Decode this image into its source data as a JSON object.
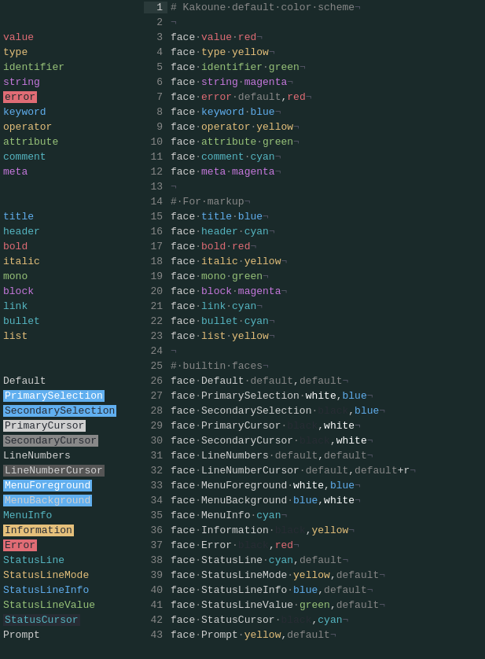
{
  "editor": {
    "title": "Kakoune default color scheme",
    "lines": [
      {
        "num": 1,
        "current": true,
        "left": "",
        "left_class": "",
        "code": "# Kakoune·default·color·scheme¬",
        "hash": true
      },
      {
        "num": 2,
        "left": "",
        "left_class": "",
        "code": "¬",
        "hash": false
      },
      {
        "num": 3,
        "left": "value",
        "left_class": "lbl-value",
        "code": "face·value·red¬",
        "hash": false
      },
      {
        "num": 4,
        "left": "type",
        "left_class": "lbl-type",
        "code": "face·type·yellow¬",
        "hash": false
      },
      {
        "num": 5,
        "left": "identifier",
        "left_class": "lbl-identifier",
        "code": "face·identifier·green¬",
        "hash": false
      },
      {
        "num": 6,
        "left": "string",
        "left_class": "lbl-string",
        "code": "face·string·magenta¬",
        "hash": false
      },
      {
        "num": 7,
        "left": "error",
        "left_class": "lbl-error",
        "code": "face·error·default,red¬",
        "hash": false
      },
      {
        "num": 8,
        "left": "keyword",
        "left_class": "lbl-keyword",
        "code": "face·keyword·blue¬",
        "hash": false
      },
      {
        "num": 9,
        "left": "operator",
        "left_class": "lbl-operator",
        "code": "face·operator·yellow¬",
        "hash": false
      },
      {
        "num": 10,
        "left": "attribute",
        "left_class": "lbl-attribute",
        "code": "face·attribute·green¬",
        "hash": false
      },
      {
        "num": 11,
        "left": "comment",
        "left_class": "lbl-comment",
        "code": "face·comment·cyan¬",
        "hash": false
      },
      {
        "num": 12,
        "left": "meta",
        "left_class": "lbl-meta",
        "code": "face·meta·magenta¬",
        "hash": false
      },
      {
        "num": 13,
        "left": "",
        "left_class": "",
        "code": "¬",
        "hash": false
      },
      {
        "num": 14,
        "left": "",
        "left_class": "",
        "code": "#·For·markup¬",
        "hash": true
      },
      {
        "num": 15,
        "left": "title",
        "left_class": "lbl-title",
        "code": "face·title·blue¬",
        "hash": false
      },
      {
        "num": 16,
        "left": "header",
        "left_class": "lbl-header",
        "code": "face·header·cyan¬",
        "hash": false
      },
      {
        "num": 17,
        "left": "bold",
        "left_class": "lbl-bold",
        "code": "face·bold·red¬",
        "hash": false
      },
      {
        "num": 18,
        "left": "italic",
        "left_class": "lbl-italic",
        "code": "face·italic·yellow¬",
        "hash": false
      },
      {
        "num": 19,
        "left": "mono",
        "left_class": "lbl-mono",
        "code": "face·mono·green¬",
        "hash": false
      },
      {
        "num": 20,
        "left": "block",
        "left_class": "lbl-block",
        "code": "face·block·magenta¬",
        "hash": false
      },
      {
        "num": 21,
        "left": "link",
        "left_class": "lbl-link",
        "code": "face·link·cyan¬",
        "hash": false
      },
      {
        "num": 22,
        "left": "bullet",
        "left_class": "lbl-bullet",
        "code": "face·bullet·cyan¬",
        "hash": false
      },
      {
        "num": 23,
        "left": "list",
        "left_class": "lbl-list",
        "code": "face·list·yellow¬",
        "hash": false
      },
      {
        "num": 24,
        "left": "",
        "left_class": "",
        "code": "¬",
        "hash": false
      },
      {
        "num": 25,
        "left": "",
        "left_class": "",
        "code": "#·builtin·faces¬",
        "hash": true
      },
      {
        "num": 26,
        "left": "Default",
        "left_class": "lbl-default",
        "code": "face·Default·default,default¬",
        "hash": false
      },
      {
        "num": 27,
        "left": "PrimarySelection",
        "left_class": "lbl-primaryselection",
        "code": "face·PrimarySelection·white,blue¬",
        "hash": false
      },
      {
        "num": 28,
        "left": "SecondarySelection",
        "left_class": "lbl-secondaryselection",
        "code": "face·SecondarySelection·black,blue¬",
        "hash": false
      },
      {
        "num": 29,
        "left": "PrimaryCursor",
        "left_class": "lbl-primarycursor",
        "code": "face·PrimaryCursor·black,white¬",
        "hash": false
      },
      {
        "num": 30,
        "left": "SecondaryCursor",
        "left_class": "lbl-secondarycursor",
        "code": "face·SecondaryCursor·black,white¬",
        "hash": false
      },
      {
        "num": 31,
        "left": "LineNumbers",
        "left_class": "lbl-linenumbers",
        "code": "face·LineNumbers·default,default¬",
        "hash": false
      },
      {
        "num": 32,
        "left": "LineNumberCursor",
        "left_class": "lbl-linenumbercursor",
        "code": "face·LineNumberCursor·default,default+r¬",
        "hash": false
      },
      {
        "num": 33,
        "left": "MenuForeground",
        "left_class": "lbl-menuforeground",
        "code": "face·MenuForeground·white,blue¬",
        "hash": false
      },
      {
        "num": 34,
        "left": "MenuBackground",
        "left_class": "lbl-menubackground",
        "code": "face·MenuBackground·blue,white¬",
        "hash": false
      },
      {
        "num": 35,
        "left": "MenuInfo",
        "left_class": "lbl-menuinfo",
        "code": "face·MenuInfo·cyan¬",
        "hash": false
      },
      {
        "num": 36,
        "left": "Information",
        "left_class": "lbl-information",
        "code": "face·Information·black,yellow¬",
        "hash": false
      },
      {
        "num": 37,
        "left": "Error",
        "left_class": "lbl-error2",
        "code": "face·Error·black,red¬",
        "hash": false
      },
      {
        "num": 38,
        "left": "StatusLine",
        "left_class": "lbl-statusline",
        "code": "face·StatusLine·cyan,default¬",
        "hash": false
      },
      {
        "num": 39,
        "left": "StatusLineMode",
        "left_class": "lbl-statuslinemode",
        "code": "face·StatusLineMode·yellow,default¬",
        "hash": false
      },
      {
        "num": 40,
        "left": "StatusLineInfo",
        "left_class": "lbl-statuslineinfo",
        "code": "face·StatusLineInfo·blue,default¬",
        "hash": false
      },
      {
        "num": 41,
        "left": "StatusLineValue",
        "left_class": "lbl-statuslinevalue",
        "code": "face·StatusLineValue·green,default¬",
        "hash": false
      },
      {
        "num": 42,
        "left": "StatusCursor",
        "left_class": "lbl-statuscursor",
        "code": "face·StatusCursor·black,cyan¬",
        "hash": false
      },
      {
        "num": 43,
        "left": "Prompt",
        "left_class": "lbl-prompt",
        "code": "face·Prompt·yellow,default¬",
        "hash": false
      }
    ]
  }
}
